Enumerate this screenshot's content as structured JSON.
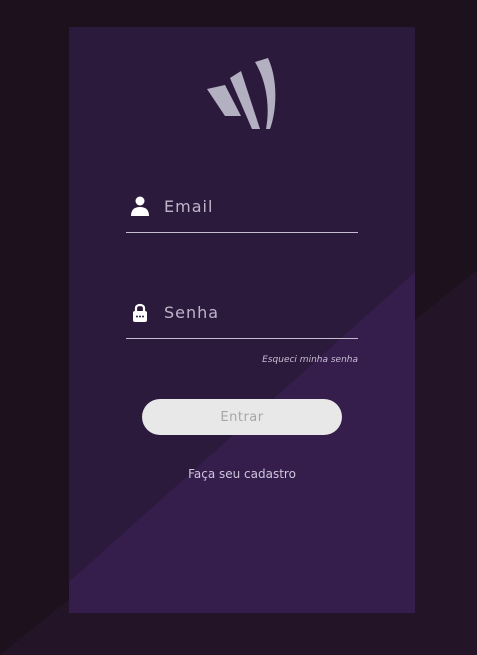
{
  "colors": {
    "page_background": "#1c111c",
    "page_background_accent": "#241428",
    "card_background": "#2c1a3c",
    "card_background_accent": "#351d4c",
    "logo": "#b3b1c1",
    "field_underline": "#c7bdd3",
    "button_background": "#e8e8e8",
    "button_text": "#a6a6a6"
  },
  "logo": {
    "icon": "wing-logo-icon"
  },
  "login": {
    "email": {
      "icon": "user-icon",
      "placeholder": "Email",
      "value": ""
    },
    "password": {
      "icon": "lock-icon",
      "placeholder": "Senha",
      "value": ""
    },
    "forgot_password_label": "Esqueci minha senha",
    "submit_label": "Entrar",
    "signup_label": "Faça seu cadastro"
  }
}
